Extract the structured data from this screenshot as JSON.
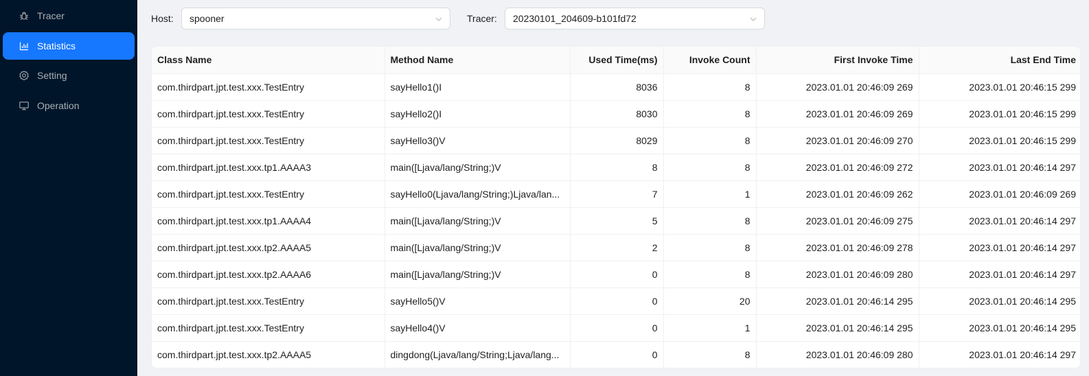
{
  "sidebar": {
    "items": [
      {
        "label": "Tracer",
        "icon": "bug-icon",
        "active": false
      },
      {
        "label": "Statistics",
        "icon": "bar-chart-icon",
        "active": true
      },
      {
        "label": "Setting",
        "icon": "gear-icon",
        "active": false
      },
      {
        "label": "Operation",
        "icon": "desktop-icon",
        "active": false
      }
    ]
  },
  "filters": {
    "host_label": "Host:",
    "host_value": "spooner",
    "tracer_label": "Tracer:",
    "tracer_value": "20230101_204609-b101fd72"
  },
  "table": {
    "columns": [
      "Class Name",
      "Method Name",
      "Used Time(ms)",
      "Invoke Count",
      "First Invoke Time",
      "Last End Time"
    ],
    "rows": [
      [
        "com.thirdpart.jpt.test.xxx.TestEntry",
        "sayHello1()I",
        "8036",
        "8",
        "2023.01.01 20:46:09 269",
        "2023.01.01 20:46:15 299"
      ],
      [
        "com.thirdpart.jpt.test.xxx.TestEntry",
        "sayHello2()I",
        "8030",
        "8",
        "2023.01.01 20:46:09 269",
        "2023.01.01 20:46:15 299"
      ],
      [
        "com.thirdpart.jpt.test.xxx.TestEntry",
        "sayHello3()V",
        "8029",
        "8",
        "2023.01.01 20:46:09 270",
        "2023.01.01 20:46:15 299"
      ],
      [
        "com.thirdpart.jpt.test.xxx.tp1.AAAA3",
        "main([Ljava/lang/String;)V",
        "8",
        "8",
        "2023.01.01 20:46:09 272",
        "2023.01.01 20:46:14 297"
      ],
      [
        "com.thirdpart.jpt.test.xxx.TestEntry",
        "sayHello0(Ljava/lang/String;)Ljava/lan...",
        "7",
        "1",
        "2023.01.01 20:46:09 262",
        "2023.01.01 20:46:09 269"
      ],
      [
        "com.thirdpart.jpt.test.xxx.tp1.AAAA4",
        "main([Ljava/lang/String;)V",
        "5",
        "8",
        "2023.01.01 20:46:09 275",
        "2023.01.01 20:46:14 297"
      ],
      [
        "com.thirdpart.jpt.test.xxx.tp2.AAAA5",
        "main([Ljava/lang/String;)V",
        "2",
        "8",
        "2023.01.01 20:46:09 278",
        "2023.01.01 20:46:14 297"
      ],
      [
        "com.thirdpart.jpt.test.xxx.tp2.AAAA6",
        "main([Ljava/lang/String;)V",
        "0",
        "8",
        "2023.01.01 20:46:09 280",
        "2023.01.01 20:46:14 297"
      ],
      [
        "com.thirdpart.jpt.test.xxx.TestEntry",
        "sayHello5()V",
        "0",
        "20",
        "2023.01.01 20:46:14 295",
        "2023.01.01 20:46:14 295"
      ],
      [
        "com.thirdpart.jpt.test.xxx.TestEntry",
        "sayHello4()V",
        "0",
        "1",
        "2023.01.01 20:46:14 295",
        "2023.01.01 20:46:14 295"
      ],
      [
        "com.thirdpart.jpt.test.xxx.tp2.AAAA5",
        "dingdong(Ljava/lang/String;Ljava/lang...",
        "0",
        "8",
        "2023.01.01 20:46:09 280",
        "2023.01.01 20:46:14 297"
      ]
    ]
  },
  "colors": {
    "sidebar_bg": "#001529",
    "accent": "#1677ff",
    "page_bg": "#f0f2f5"
  }
}
